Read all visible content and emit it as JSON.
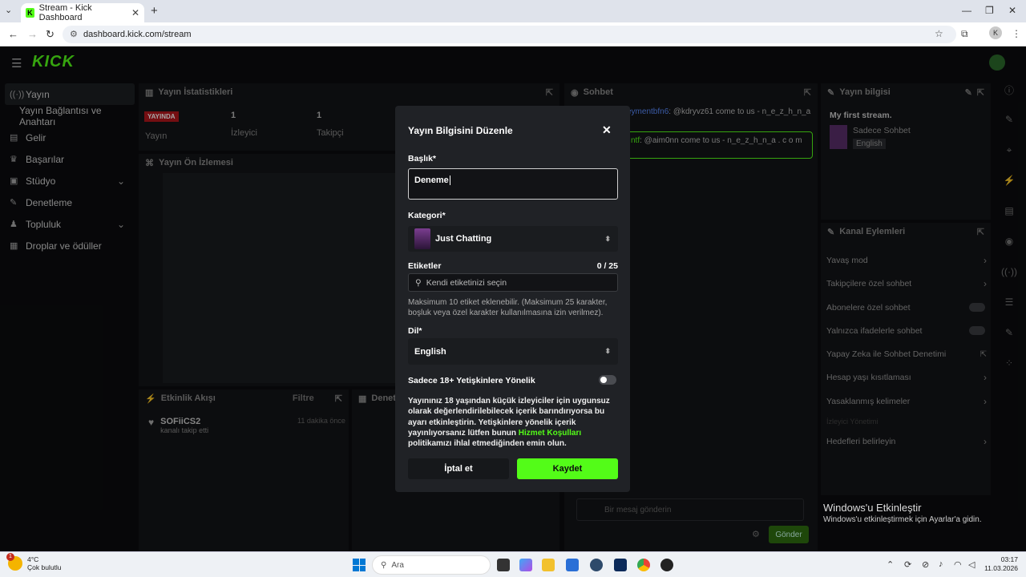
{
  "browser": {
    "tab_title": "Stream - Kick Dashboard",
    "tab_favicon": "K",
    "url": "dashboard.kick.com/stream",
    "profile_initial": "K"
  },
  "app": {
    "logo": "KICK",
    "sidebar": {
      "items": [
        {
          "icon": "broadcast-icon",
          "label": "Yayın"
        },
        {
          "icon": "",
          "label": "Yayın Bağlantısı ve Anahtarı"
        },
        {
          "icon": "wallet-icon",
          "label": "Gelir"
        },
        {
          "icon": "trophy-icon",
          "label": "Başarılar"
        },
        {
          "icon": "studio-icon",
          "label": "Stüdyo"
        },
        {
          "icon": "shield-icon",
          "label": "Denetleme"
        },
        {
          "icon": "community-icon",
          "label": "Topluluk"
        },
        {
          "icon": "gift-icon",
          "label": "Droplar ve ödüller"
        }
      ]
    },
    "stats": {
      "title": "Yayın İstatistikleri",
      "live_badge": "YAYINDA",
      "live_label": "Yayın",
      "viewers_value": "1",
      "viewers_label": "İzleyici",
      "followers_value": "1",
      "followers_label": "Takipçi"
    },
    "preview": {
      "title": "Yayın Ön İzlemesi"
    },
    "chat": {
      "title": "Sohbet",
      "msg1_user": "eymentbfn6",
      "msg1_text": ": @kdryvz61 come to us - n_e_z_h_n_a .",
      "msg2_user": "ntf",
      "msg2_text": ": @aim0nn come to us - n_e_z_h_n_a . c o m",
      "send_placeholder": "Bir mesaj gönderin",
      "send_button": "Gönder"
    },
    "activity": {
      "title": "Etkinlik Akışı",
      "filter": "Filtre",
      "item_user": "SOFiiCS2",
      "item_text": "kanalı takip etti",
      "item_time": "11 dakika önce"
    },
    "mod_panel": {
      "title": "Denetim"
    },
    "stream_info": {
      "title": "Yayın bilgisi",
      "stream_title": "My first stream.",
      "category": "Sadece Sohbet",
      "language": "English"
    },
    "channel_actions": {
      "title": "Kanal Eylemleri",
      "items": [
        "Yavaş mod",
        "Takipçilere özel sohbet",
        "Abonelere özel sohbet",
        "Yalnızca ifadelerle sohbet",
        "Yapay Zeka ile Sohbet Denetimi",
        "Hesap yaşı kısıtlaması",
        "Yasaklanmış kelimeler",
        "İzleyici Yönetimi",
        "Hedefleri belirleyin"
      ]
    }
  },
  "modal": {
    "title": "Yayın Bilgisini Düzenle",
    "title_label": "Başlık*",
    "title_value": "Deneme",
    "category_label": "Kategori*",
    "category_value": "Just Chatting",
    "tags_label": "Etiketler",
    "tags_count": "0 / 25",
    "tags_placeholder": "Kendi etiketinizi seçin",
    "tags_help": "Maksimum 10 etiket eklenebilir. (Maksimum 25 karakter, boşluk veya özel karakter kullanılmasına izin verilmez).",
    "language_label": "Dil*",
    "language_value": "English",
    "mature_label": "Sadece 18+ Yetişkinlere Yönelik",
    "mature_enabled": false,
    "warning_part1": "Yayınınız 18 yaşından küçük izleyiciler için uygunsuz olarak değerlendirilebilecek içerik barındırıyorsa bu ayarı etkinleştirin. Yetişkinlere yönelik içerik yayınlıyorsanız lütfen bunun ",
    "warning_link": "Hizmet Koşulları",
    "warning_part2": " politikamızı ihlal etmediğinden emin olun.",
    "cancel_label": "İptal et",
    "save_label": "Kaydet",
    "accent_color": "#53fc18"
  },
  "windows": {
    "activate_title": "Windows'u Etkinleştir",
    "activate_text": "Windows'u etkinleştirmek için Ayarlar'a gidin."
  },
  "taskbar": {
    "weather_temp": "4°C",
    "weather_desc": "Çok bulutlu",
    "weather_badge": "1",
    "search_placeholder": "Ara",
    "time": "03:17",
    "date": "11.03.2026"
  }
}
